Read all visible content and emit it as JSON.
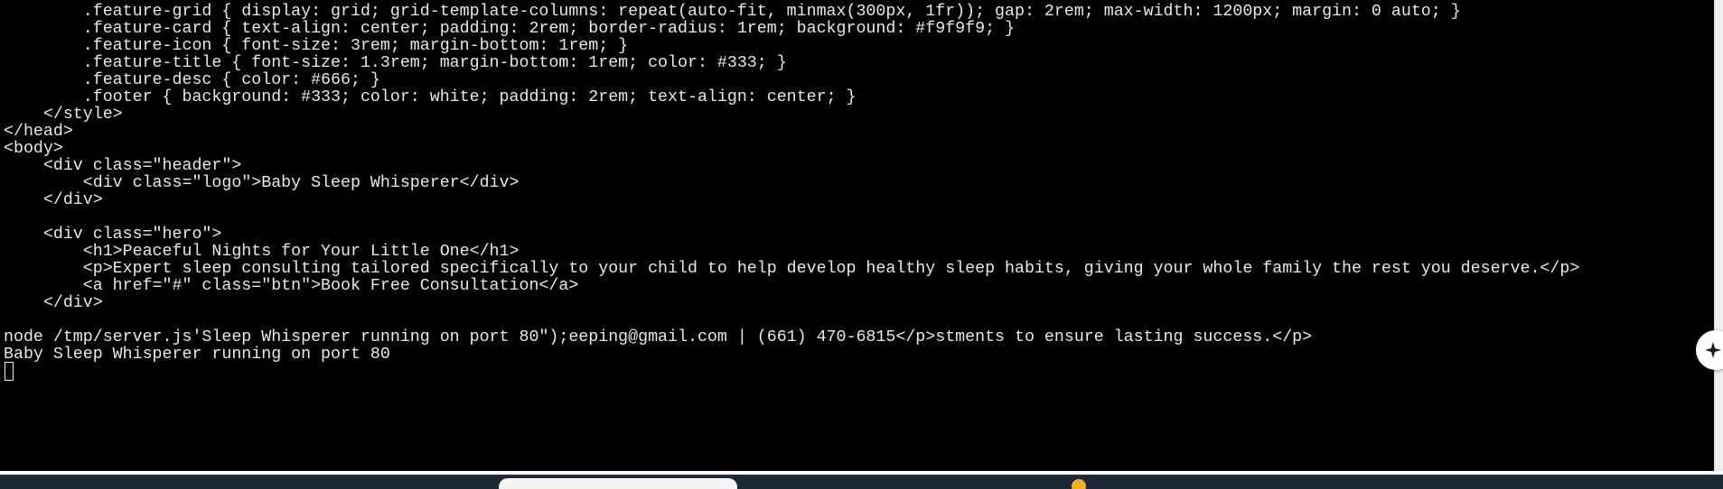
{
  "terminal": {
    "lines": [
      "        .feature-grid { display: grid; grid-template-columns: repeat(auto-fit, minmax(300px, 1fr)); gap: 2rem; max-width: 1200px; margin: 0 auto; }",
      "        .feature-card { text-align: center; padding: 2rem; border-radius: 1rem; background: #f9f9f9; }",
      "        .feature-icon { font-size: 3rem; margin-bottom: 1rem; }",
      "        .feature-title { font-size: 1.3rem; margin-bottom: 1rem; color: #333; }",
      "        .feature-desc { color: #666; }",
      "        .footer { background: #333; color: white; padding: 2rem; text-align: center; }",
      "    </style>",
      "</head>",
      "<body>",
      "    <div class=\"header\">",
      "        <div class=\"logo\">Baby Sleep Whisperer</div>",
      "    </div>",
      "",
      "    <div class=\"hero\">",
      "        <h1>Peaceful Nights for Your Little One</h1>",
      "        <p>Expert sleep consulting tailored specifically to your child to help develop healthy sleep habits, giving your whole family the rest you deserve.</p>",
      "        <a href=\"#\" class=\"btn\">Book Free Consultation</a>",
      "    </div>",
      "",
      "node /tmp/server.js'Sleep Whisperer running on port 80\");eeping@gmail.com | (661) 470-6815</p>stments to ensure lasting success.</p>",
      "Baby Sleep Whisperer running on port 80"
    ]
  },
  "colors": {
    "terminal_bg": "#000000",
    "terminal_fg": "#e8e8e8",
    "taskbar_bg": "#1c2836",
    "accent_dot": "#f2b01e"
  },
  "icons": {
    "side_button": "sparkle-icon"
  }
}
